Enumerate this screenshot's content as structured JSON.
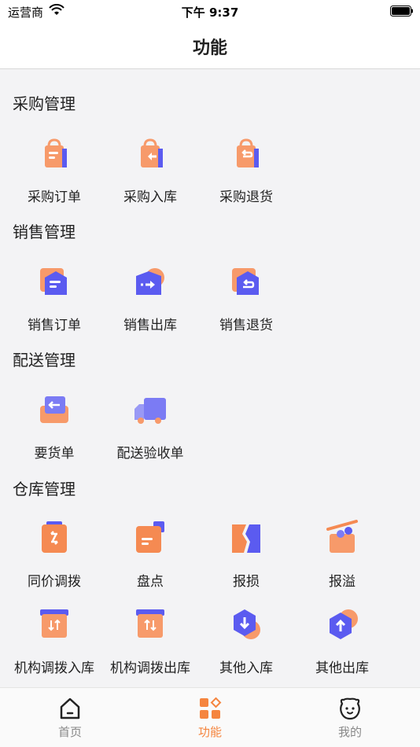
{
  "status_bar": {
    "carrier": "运营商",
    "time": "下午 9:37"
  },
  "nav": {
    "title": "功能"
  },
  "sections": [
    {
      "title": "采购管理",
      "items": [
        "采购订单",
        "采购入库",
        "采购退货"
      ]
    },
    {
      "title": "销售管理",
      "items": [
        "销售订单",
        "销售出库",
        "销售退货"
      ]
    },
    {
      "title": "配送管理",
      "items": [
        "要货单",
        "配送验收单"
      ]
    },
    {
      "title": "仓库管理",
      "items": [
        "同价调拨",
        "盘点",
        "报损",
        "报溢",
        "机构调拨入库",
        "机构调拨出库",
        "其他入库",
        "其他出库"
      ]
    }
  ],
  "tabs": [
    {
      "label": "首页",
      "icon": "home-icon"
    },
    {
      "label": "功能",
      "icon": "grid-icon",
      "active": true
    },
    {
      "label": "我的",
      "icon": "profile-icon"
    }
  ],
  "colors": {
    "accent": "#f5853f",
    "purple": "#5b5bf0"
  }
}
